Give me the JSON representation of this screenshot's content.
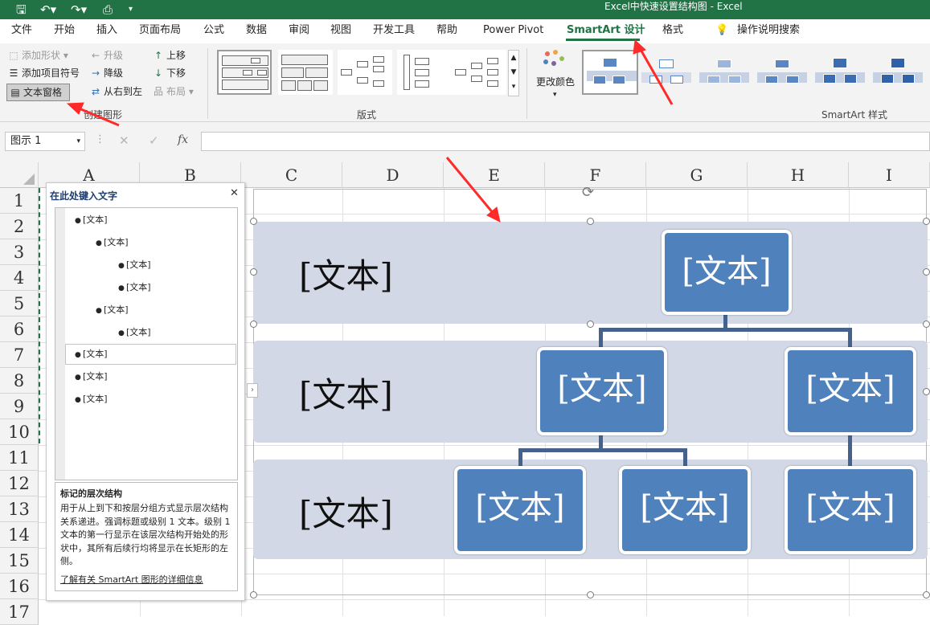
{
  "title_bar": {
    "title": "Excel中快速设置结构图  -  Excel",
    "quick_access": [
      "save-icon",
      "undo-icon",
      "redo-icon",
      "print-preview-icon",
      "customize-icon"
    ]
  },
  "menu": {
    "items": [
      "文件",
      "开始",
      "插入",
      "页面布局",
      "公式",
      "数据",
      "审阅",
      "视图",
      "开发工具",
      "帮助",
      "Power Pivot",
      "SmartArt 设计",
      "格式"
    ],
    "active": "SmartArt 设计",
    "search": "操作说明搜索"
  },
  "ribbon": {
    "create_graphic": {
      "add_shape": "添加形状",
      "add_bullet": "添加项目符号",
      "text_pane": "文本窗格",
      "promote": "升级",
      "demote": "降级",
      "right_to_left": "从右到左",
      "move_up": "上移",
      "move_down": "下移",
      "layout": "布局",
      "group_label": "创建图形"
    },
    "layouts": {
      "group_label": "版式"
    },
    "styles": {
      "change_colors": "更改颜色",
      "group_label": "SmartArt 样式"
    }
  },
  "formula_bar": {
    "name_box": "图示 1",
    "formula": ""
  },
  "grid": {
    "columns": [
      "A",
      "B",
      "C",
      "D",
      "E",
      "F",
      "G",
      "H",
      "I"
    ],
    "rows": [
      "1",
      "2",
      "3",
      "4",
      "5",
      "6",
      "7",
      "8",
      "9",
      "10",
      "11",
      "12",
      "13",
      "14",
      "15",
      "16",
      "17"
    ]
  },
  "text_pane": {
    "title": "在此处键入文字",
    "items": [
      {
        "level": 1,
        "text": "[文本]"
      },
      {
        "level": 2,
        "text": "[文本]"
      },
      {
        "level": 3,
        "text": "[文本]"
      },
      {
        "level": 3,
        "text": "[文本]"
      },
      {
        "level": 2,
        "text": "[文本]"
      },
      {
        "level": 3,
        "text": "[文本]"
      },
      {
        "level": 1,
        "text": "[文本]"
      },
      {
        "level": 1,
        "text": "[文本]"
      },
      {
        "level": 1,
        "text": "[文本]"
      }
    ],
    "description_title": "标记的层次结构",
    "description": "用于从上到下和按层分组方式显示层次结构关系递进。强调标题或级别 1 文本。级别 1 文本的第一行显示在该层次结构开始处的形状中，其所有后续行均将显示在长矩形的左侧。",
    "learn_more": "了解有关 SmartArt 图形的详细信息"
  },
  "smartart": {
    "band_labels": [
      "[文本]",
      "[文本]",
      "[文本]"
    ],
    "nodes": [
      "[文本]",
      "[文本]",
      "[文本]",
      "[文本]",
      "[文本]",
      "[文本]"
    ]
  },
  "colors": {
    "excel_green": "#217346",
    "node_blue": "#4f81bd",
    "band": "#d2d8e6",
    "arrow_red": "#ff2a2a"
  }
}
